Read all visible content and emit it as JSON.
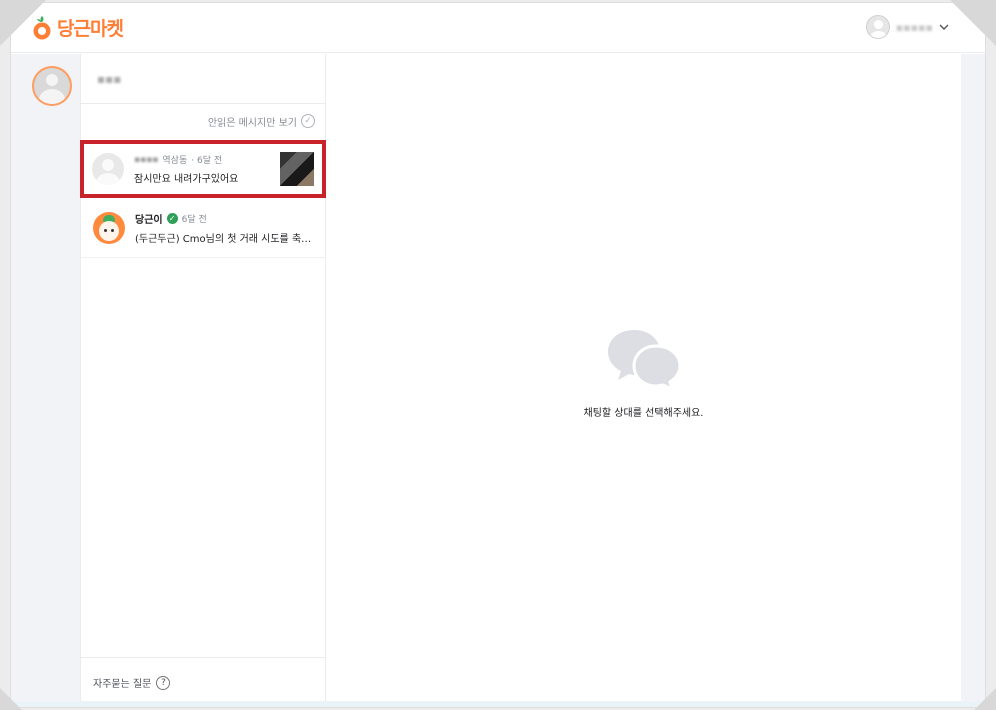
{
  "brand": {
    "logo_text": "당근마켓",
    "accent_color": "#ff7e36"
  },
  "header": {
    "user_name_blurred": "▪▪▪▪▪",
    "dropdown_icon": "chevron-down-icon"
  },
  "sidebar": {
    "profile_avatar_icon": "user-avatar-icon"
  },
  "chat_list": {
    "account_name_blurred": "▪▪▪",
    "unread_filter_label": "안읽은 메시지만 보기",
    "items": [
      {
        "name_blurred": "▪▪▪▪",
        "location": "역삼동",
        "time": "· 6달 전",
        "message": "잠시만요 내려가구있어요",
        "has_thumbnail": true,
        "selected": true
      },
      {
        "name": "당근이",
        "verified": true,
        "time": "6달 전",
        "message": "(두근두근) Cmo님의 첫 거래 시도를 축하해요",
        "has_thumbnail": false,
        "selected": false
      }
    ],
    "faq_label": "자주묻는 질문",
    "faq_icon_glyph": "?"
  },
  "main": {
    "empty_state_icon": "chat-bubbles-icon",
    "empty_state_text": "채팅할 상대를 선택해주세요."
  },
  "colors": {
    "highlight_border": "#c8232b",
    "verified_badge": "#2fa05a"
  }
}
